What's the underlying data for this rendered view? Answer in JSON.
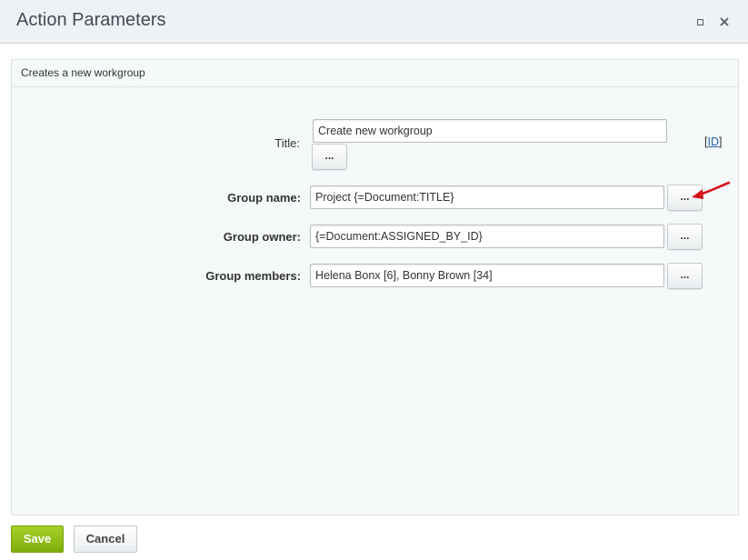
{
  "dialog": {
    "title": "Action Parameters"
  },
  "panel": {
    "header": "Creates a new workgroup"
  },
  "fields": {
    "title": {
      "label": "Title:",
      "value": "Create new workgroup",
      "button": "..."
    },
    "group_name": {
      "label": "Group name:",
      "value": "Project {=Document:TITLE}",
      "button": "..."
    },
    "group_owner": {
      "label": "Group owner:",
      "value": "{=Document:ASSIGNED_BY_ID}",
      "button": "..."
    },
    "group_members": {
      "label": "Group members:",
      "value": "Helena Bonx [6], Bonny Brown [34]",
      "button": "..."
    }
  },
  "id_link": {
    "open": "[",
    "text": "ID",
    "close": "]"
  },
  "footer": {
    "save_label": "Save",
    "cancel_label": "Cancel"
  },
  "colors": {
    "save_button": "#8bbb13",
    "annotation_arrow": "#d5141c",
    "link": "#2067b0"
  }
}
